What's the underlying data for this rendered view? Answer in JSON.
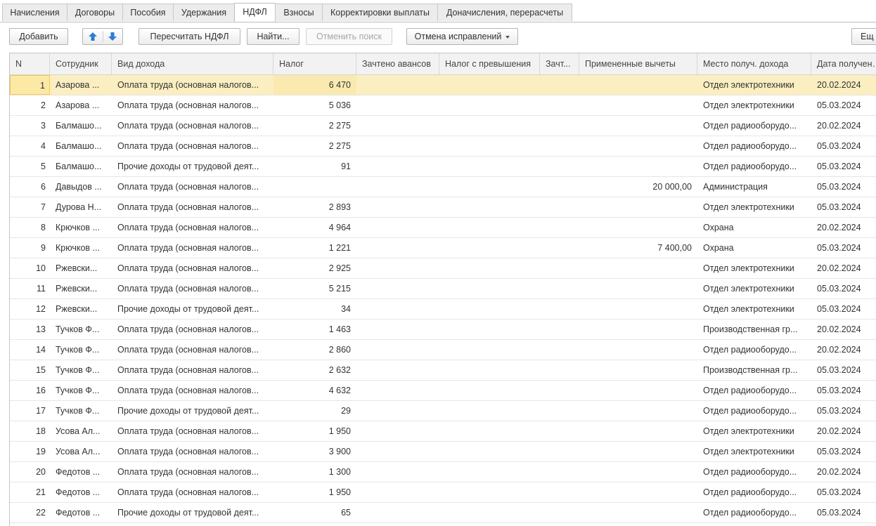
{
  "tabs": [
    {
      "label": "Начисления"
    },
    {
      "label": "Договоры"
    },
    {
      "label": "Пособия"
    },
    {
      "label": "Удержания"
    },
    {
      "label": "НДФЛ"
    },
    {
      "label": "Взносы"
    },
    {
      "label": "Корректировки выплаты"
    },
    {
      "label": "Доначисления, перерасчеты"
    }
  ],
  "active_tab": "НДФЛ",
  "toolbar": {
    "add_label": "Добавить",
    "recalc_label": "Пересчитать НДФЛ",
    "find_label": "Найти...",
    "cancel_search_label": "Отменить поиск",
    "cancel_fix_label": "Отмена исправлений",
    "more_label": "Ещ"
  },
  "columns": [
    "N",
    "Сотрудник",
    "Вид дохода",
    "Налог",
    "Зачтено авансов",
    "Налог с превышения",
    "Зачт...",
    "Примененные вычеты",
    "Место получ. дохода",
    "Дата получения"
  ],
  "rows": [
    {
      "n": "1",
      "emp": "Азарова ...",
      "income": "Оплата труда (основная налогов...",
      "tax": "6 470",
      "ded": "",
      "place": "Отдел электротехники",
      "date": "20.02.2024"
    },
    {
      "n": "2",
      "emp": "Азарова ...",
      "income": "Оплата труда (основная налогов...",
      "tax": "5 036",
      "ded": "",
      "place": "Отдел электротехники",
      "date": "05.03.2024"
    },
    {
      "n": "3",
      "emp": "Балмашо...",
      "income": "Оплата труда (основная налогов...",
      "tax": "2 275",
      "ded": "",
      "place": "Отдел радиооборудо...",
      "date": "20.02.2024"
    },
    {
      "n": "4",
      "emp": "Балмашо...",
      "income": "Оплата труда (основная налогов...",
      "tax": "2 275",
      "ded": "",
      "place": "Отдел радиооборудо...",
      "date": "05.03.2024"
    },
    {
      "n": "5",
      "emp": "Балмашо...",
      "income": "Прочие доходы от трудовой деят...",
      "tax": "91",
      "ded": "",
      "place": "Отдел радиооборудо...",
      "date": "05.03.2024"
    },
    {
      "n": "6",
      "emp": "Давыдов ...",
      "income": "Оплата труда (основная налогов...",
      "tax": "",
      "ded": "20 000,00",
      "place": "Администрация",
      "date": "05.03.2024"
    },
    {
      "n": "7",
      "emp": "Дурова Н...",
      "income": "Оплата труда (основная налогов...",
      "tax": "2 893",
      "ded": "",
      "place": "Отдел электротехники",
      "date": "05.03.2024"
    },
    {
      "n": "8",
      "emp": "Крючков ...",
      "income": "Оплата труда (основная налогов...",
      "tax": "4 964",
      "ded": "",
      "place": "Охрана",
      "date": "20.02.2024"
    },
    {
      "n": "9",
      "emp": "Крючков ...",
      "income": "Оплата труда (основная налогов...",
      "tax": "1 221",
      "ded": "7 400,00",
      "place": "Охрана",
      "date": "05.03.2024"
    },
    {
      "n": "10",
      "emp": "Ржевски...",
      "income": "Оплата труда (основная налогов...",
      "tax": "2 925",
      "ded": "",
      "place": "Отдел электротехники",
      "date": "20.02.2024"
    },
    {
      "n": "11",
      "emp": "Ржевски...",
      "income": "Оплата труда (основная налогов...",
      "tax": "5 215",
      "ded": "",
      "place": "Отдел электротехники",
      "date": "05.03.2024"
    },
    {
      "n": "12",
      "emp": "Ржевски...",
      "income": "Прочие доходы от трудовой деят...",
      "tax": "34",
      "ded": "",
      "place": "Отдел электротехники",
      "date": "05.03.2024"
    },
    {
      "n": "13",
      "emp": "Тучков Ф...",
      "income": "Оплата труда (основная налогов...",
      "tax": "1 463",
      "ded": "",
      "place": "Производственная гр...",
      "date": "20.02.2024"
    },
    {
      "n": "14",
      "emp": "Тучков Ф...",
      "income": "Оплата труда (основная налогов...",
      "tax": "2 860",
      "ded": "",
      "place": "Отдел радиооборудо...",
      "date": "20.02.2024"
    },
    {
      "n": "15",
      "emp": "Тучков Ф...",
      "income": "Оплата труда (основная налогов...",
      "tax": "2 632",
      "ded": "",
      "place": "Производственная гр...",
      "date": "05.03.2024"
    },
    {
      "n": "16",
      "emp": "Тучков Ф...",
      "income": "Оплата труда (основная налогов...",
      "tax": "4 632",
      "ded": "",
      "place": "Отдел радиооборудо...",
      "date": "05.03.2024"
    },
    {
      "n": "17",
      "emp": "Тучков Ф...",
      "income": "Прочие доходы от трудовой деят...",
      "tax": "29",
      "ded": "",
      "place": "Отдел радиооборудо...",
      "date": "05.03.2024"
    },
    {
      "n": "18",
      "emp": "Усова Ал...",
      "income": "Оплата труда (основная налогов...",
      "tax": "1 950",
      "ded": "",
      "place": "Отдел электротехники",
      "date": "20.02.2024"
    },
    {
      "n": "19",
      "emp": "Усова Ал...",
      "income": "Оплата труда (основная налогов...",
      "tax": "3 900",
      "ded": "",
      "place": "Отдел электротехники",
      "date": "05.03.2024"
    },
    {
      "n": "20",
      "emp": "Федотов ...",
      "income": "Оплата труда (основная налогов...",
      "tax": "1 300",
      "ded": "",
      "place": "Отдел радиооборудо...",
      "date": "20.02.2024"
    },
    {
      "n": "21",
      "emp": "Федотов ...",
      "income": "Оплата труда (основная налогов...",
      "tax": "1 950",
      "ded": "",
      "place": "Отдел радиооборудо...",
      "date": "05.03.2024"
    },
    {
      "n": "22",
      "emp": "Федотов ...",
      "income": "Прочие доходы от трудовой деят...",
      "tax": "65",
      "ded": "",
      "place": "Отдел радиооборудо...",
      "date": "05.03.2024"
    }
  ],
  "selected_row": "1",
  "colors": {
    "selection": "#fbeec0",
    "arrow": "#2e7bd6"
  }
}
